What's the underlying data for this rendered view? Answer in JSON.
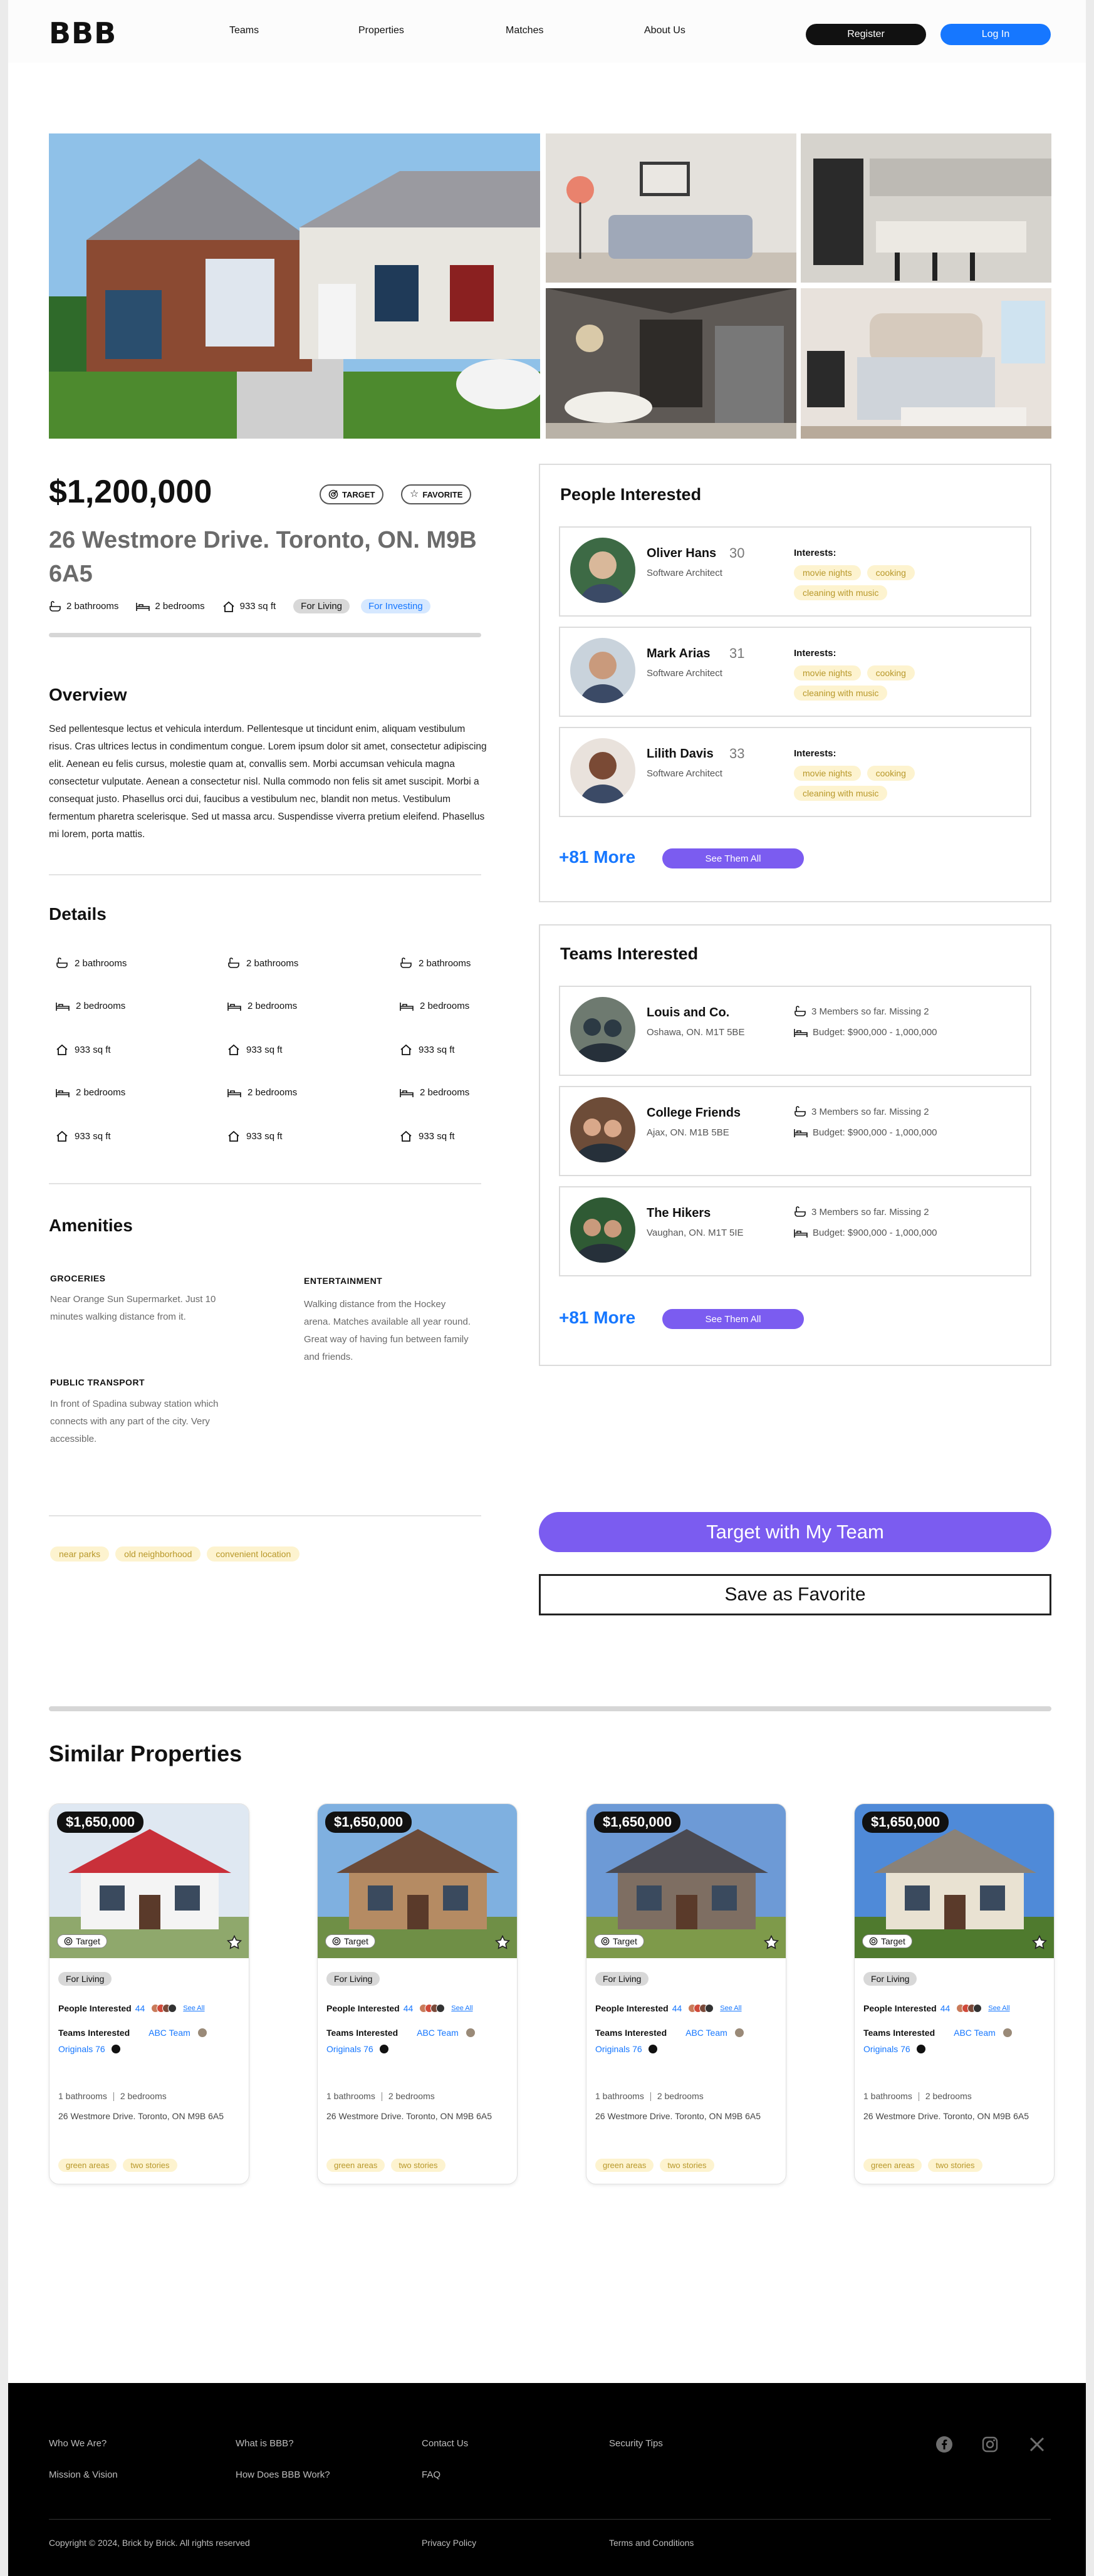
{
  "nav": {
    "logo": "BBB",
    "links": [
      "Teams",
      "Properties",
      "Matches",
      "About Us"
    ],
    "register": "Register",
    "login": "Log In"
  },
  "property": {
    "price": "$1,200,000",
    "target_label": "TARGET",
    "favorite_label": "FAVORITE",
    "address": "26 Westmore Drive. Toronto, ON. M9B 6A5",
    "bathrooms": "2 bathrooms",
    "bedrooms": "2 bedrooms",
    "area": "933 sq ft",
    "tag_living": "For Living",
    "tag_investing": "For Investing"
  },
  "overview": {
    "title": "Overview",
    "text": "Sed pellentesque lectus et vehicula interdum. Pellentesque ut tincidunt enim, aliquam vestibulum risus. Cras ultrices lectus in condimentum congue. Lorem ipsum dolor sit amet, consectetur adipiscing elit. Aenean eu felis cursus, molestie quam at, convallis sem. Morbi accumsan vehicula magna consectetur vulputate. Aenean a consectetur nisl. Nulla commodo non felis sit amet suscipit. Morbi a consequat justo. Phasellus orci dui, faucibus a vestibulum nec, blandit non metus. Vestibulum fermentum pharetra scelerisque. Sed ut massa arcu. Suspendisse viverra pretium eleifend. Phasellus mi lorem, porta mattis."
  },
  "details": {
    "title": "Details",
    "rows": [
      [
        "2 bathrooms",
        "2 bathrooms",
        "2 bathrooms"
      ],
      [
        "2 bedrooms",
        "2 bedrooms",
        "2 bedrooms"
      ],
      [
        "933 sq ft",
        "933 sq ft",
        "933 sq ft"
      ],
      [
        "2 bedrooms",
        "2 bedrooms",
        "2 bedrooms"
      ],
      [
        "933 sq ft",
        "933 sq ft",
        "933 sq ft"
      ]
    ]
  },
  "amenities": {
    "title": "Amenities",
    "groceries_h": "GROCERIES",
    "groceries_t": "Near Orange Sun Supermarket. Just 10 minutes walking distance from it.",
    "entertainment_h": "ENTERTAINMENT",
    "entertainment_t": "Walking distance from the Hockey arena. Matches available all year round. Great way of having fun between family and friends.",
    "transport_h": "PUBLIC TRANSPORT",
    "transport_t": "In front of Spadina subway station which connects with any part of the city. Very accessible."
  },
  "tags": [
    "near parks",
    "old neighborhood",
    "convenient location"
  ],
  "people": {
    "title": "People Interested",
    "interests_label": "Interests:",
    "list": [
      {
        "name": "Oliver Hans",
        "age": "30",
        "role": "Software Architect",
        "interests": [
          "movie nights",
          "cooking",
          "cleaning with music"
        ]
      },
      {
        "name": "Mark Arias",
        "age": "31",
        "role": "Software Architect",
        "interests": [
          "movie nights",
          "cooking",
          "cleaning with music"
        ]
      },
      {
        "name": "Lilith Davis",
        "age": "33",
        "role": "Software Architect",
        "interests": [
          "movie nights",
          "cooking",
          "cleaning with music"
        ]
      }
    ],
    "more": "+81 More",
    "see_all": "See Them All"
  },
  "teams": {
    "title": "Teams Interested",
    "list": [
      {
        "name": "Louis and Co.",
        "location": "Oshawa, ON. M1T 5BE",
        "members": "3 Members so far. Missing 2",
        "budget": "Budget: $900,000 - 1,000,000"
      },
      {
        "name": "College Friends",
        "location": "Ajax, ON. M1B 5BE",
        "members": "3 Members so far. Missing 2",
        "budget": "Budget: $900,000 - 1,000,000"
      },
      {
        "name": "The Hikers",
        "location": "Vaughan, ON. M1T 5IE",
        "members": "3 Members so far. Missing 2",
        "budget": "Budget: $900,000 - 1,000,000"
      }
    ],
    "more": "+81 More",
    "see_all": "See Them All"
  },
  "cta": {
    "target": "Target with My Team",
    "favorite": "Save as Favorite"
  },
  "similar": {
    "title": "Similar Properties",
    "cards": [
      {
        "price": "$1,650,000",
        "target": "Target",
        "for_living": "For Living",
        "people_label": "People Interested",
        "people_count": "44",
        "see_all": "See All",
        "teams_label": "Teams Interested",
        "team1": "ABC Team",
        "team2": "Originals 76",
        "baths": "1 bathrooms",
        "beds": "2 bedrooms",
        "address": "26 Westmore Drive. Toronto, ON M9B 6A5",
        "tags": [
          "green areas",
          "two stories"
        ]
      },
      {
        "price": "$1,650,000",
        "target": "Target",
        "for_living": "For Living",
        "people_label": "People Interested",
        "people_count": "44",
        "see_all": "See All",
        "teams_label": "Teams Interested",
        "team1": "ABC Team",
        "team2": "Originals 76",
        "baths": "1 bathrooms",
        "beds": "2 bedrooms",
        "address": "26 Westmore Drive. Toronto, ON M9B 6A5",
        "tags": [
          "green areas",
          "two stories"
        ]
      },
      {
        "price": "$1,650,000",
        "target": "Target",
        "for_living": "For Living",
        "people_label": "People Interested",
        "people_count": "44",
        "see_all": "See All",
        "teams_label": "Teams Interested",
        "team1": "ABC Team",
        "team2": "Originals 76",
        "baths": "1 bathrooms",
        "beds": "2 bedrooms",
        "address": "26 Westmore Drive. Toronto, ON M9B 6A5",
        "tags": [
          "green areas",
          "two stories"
        ]
      },
      {
        "price": "$1,650,000",
        "target": "Target",
        "for_living": "For Living",
        "people_label": "People Interested",
        "people_count": "44",
        "see_all": "See All",
        "teams_label": "Teams Interested",
        "team1": "ABC Team",
        "team2": "Originals 76",
        "baths": "1 bathrooms",
        "beds": "2 bedrooms",
        "address": "26 Westmore Drive. Toronto, ON M9B 6A5",
        "tags": [
          "green areas",
          "two stories"
        ]
      }
    ]
  },
  "footer": {
    "col1": [
      "Who We Are?",
      "Mission & Vision"
    ],
    "col2": [
      "What is BBB?",
      "How Does BBB Work?"
    ],
    "col3": [
      "Contact Us",
      "FAQ"
    ],
    "col4": [
      "Security Tips"
    ],
    "copyright": "Copyright © 2024, Brick by Brick. All rights reserved",
    "privacy": "Privacy Policy",
    "terms": "Terms and Conditions",
    "social_icons": [
      "facebook-icon",
      "instagram-icon",
      "x-icon"
    ]
  },
  "colors": {
    "accent_blue": "#1677ff",
    "accent_purple": "#7b5cf0",
    "tag_yellow_bg": "#fdf3cf"
  }
}
